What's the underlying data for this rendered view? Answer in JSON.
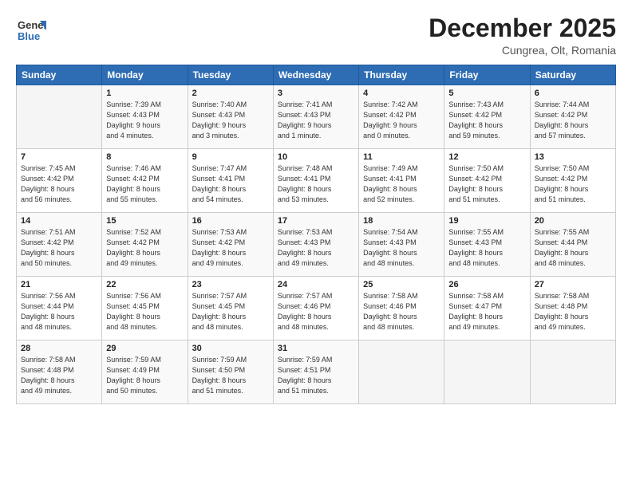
{
  "logo": {
    "line1": "General",
    "line2": "Blue"
  },
  "title": "December 2025",
  "location": "Cungrea, Olt, Romania",
  "days_of_week": [
    "Sunday",
    "Monday",
    "Tuesday",
    "Wednesday",
    "Thursday",
    "Friday",
    "Saturday"
  ],
  "weeks": [
    [
      {
        "day": "",
        "info": ""
      },
      {
        "day": "1",
        "info": "Sunrise: 7:39 AM\nSunset: 4:43 PM\nDaylight: 9 hours\nand 4 minutes."
      },
      {
        "day": "2",
        "info": "Sunrise: 7:40 AM\nSunset: 4:43 PM\nDaylight: 9 hours\nand 3 minutes."
      },
      {
        "day": "3",
        "info": "Sunrise: 7:41 AM\nSunset: 4:43 PM\nDaylight: 9 hours\nand 1 minute."
      },
      {
        "day": "4",
        "info": "Sunrise: 7:42 AM\nSunset: 4:42 PM\nDaylight: 9 hours\nand 0 minutes."
      },
      {
        "day": "5",
        "info": "Sunrise: 7:43 AM\nSunset: 4:42 PM\nDaylight: 8 hours\nand 59 minutes."
      },
      {
        "day": "6",
        "info": "Sunrise: 7:44 AM\nSunset: 4:42 PM\nDaylight: 8 hours\nand 57 minutes."
      }
    ],
    [
      {
        "day": "7",
        "info": "Sunrise: 7:45 AM\nSunset: 4:42 PM\nDaylight: 8 hours\nand 56 minutes."
      },
      {
        "day": "8",
        "info": "Sunrise: 7:46 AM\nSunset: 4:42 PM\nDaylight: 8 hours\nand 55 minutes."
      },
      {
        "day": "9",
        "info": "Sunrise: 7:47 AM\nSunset: 4:41 PM\nDaylight: 8 hours\nand 54 minutes."
      },
      {
        "day": "10",
        "info": "Sunrise: 7:48 AM\nSunset: 4:41 PM\nDaylight: 8 hours\nand 53 minutes."
      },
      {
        "day": "11",
        "info": "Sunrise: 7:49 AM\nSunset: 4:41 PM\nDaylight: 8 hours\nand 52 minutes."
      },
      {
        "day": "12",
        "info": "Sunrise: 7:50 AM\nSunset: 4:42 PM\nDaylight: 8 hours\nand 51 minutes."
      },
      {
        "day": "13",
        "info": "Sunrise: 7:50 AM\nSunset: 4:42 PM\nDaylight: 8 hours\nand 51 minutes."
      }
    ],
    [
      {
        "day": "14",
        "info": "Sunrise: 7:51 AM\nSunset: 4:42 PM\nDaylight: 8 hours\nand 50 minutes."
      },
      {
        "day": "15",
        "info": "Sunrise: 7:52 AM\nSunset: 4:42 PM\nDaylight: 8 hours\nand 49 minutes."
      },
      {
        "day": "16",
        "info": "Sunrise: 7:53 AM\nSunset: 4:42 PM\nDaylight: 8 hours\nand 49 minutes."
      },
      {
        "day": "17",
        "info": "Sunrise: 7:53 AM\nSunset: 4:43 PM\nDaylight: 8 hours\nand 49 minutes."
      },
      {
        "day": "18",
        "info": "Sunrise: 7:54 AM\nSunset: 4:43 PM\nDaylight: 8 hours\nand 48 minutes."
      },
      {
        "day": "19",
        "info": "Sunrise: 7:55 AM\nSunset: 4:43 PM\nDaylight: 8 hours\nand 48 minutes."
      },
      {
        "day": "20",
        "info": "Sunrise: 7:55 AM\nSunset: 4:44 PM\nDaylight: 8 hours\nand 48 minutes."
      }
    ],
    [
      {
        "day": "21",
        "info": "Sunrise: 7:56 AM\nSunset: 4:44 PM\nDaylight: 8 hours\nand 48 minutes."
      },
      {
        "day": "22",
        "info": "Sunrise: 7:56 AM\nSunset: 4:45 PM\nDaylight: 8 hours\nand 48 minutes."
      },
      {
        "day": "23",
        "info": "Sunrise: 7:57 AM\nSunset: 4:45 PM\nDaylight: 8 hours\nand 48 minutes."
      },
      {
        "day": "24",
        "info": "Sunrise: 7:57 AM\nSunset: 4:46 PM\nDaylight: 8 hours\nand 48 minutes."
      },
      {
        "day": "25",
        "info": "Sunrise: 7:58 AM\nSunset: 4:46 PM\nDaylight: 8 hours\nand 48 minutes."
      },
      {
        "day": "26",
        "info": "Sunrise: 7:58 AM\nSunset: 4:47 PM\nDaylight: 8 hours\nand 49 minutes."
      },
      {
        "day": "27",
        "info": "Sunrise: 7:58 AM\nSunset: 4:48 PM\nDaylight: 8 hours\nand 49 minutes."
      }
    ],
    [
      {
        "day": "28",
        "info": "Sunrise: 7:58 AM\nSunset: 4:48 PM\nDaylight: 8 hours\nand 49 minutes."
      },
      {
        "day": "29",
        "info": "Sunrise: 7:59 AM\nSunset: 4:49 PM\nDaylight: 8 hours\nand 50 minutes."
      },
      {
        "day": "30",
        "info": "Sunrise: 7:59 AM\nSunset: 4:50 PM\nDaylight: 8 hours\nand 51 minutes."
      },
      {
        "day": "31",
        "info": "Sunrise: 7:59 AM\nSunset: 4:51 PM\nDaylight: 8 hours\nand 51 minutes."
      },
      {
        "day": "",
        "info": ""
      },
      {
        "day": "",
        "info": ""
      },
      {
        "day": "",
        "info": ""
      }
    ]
  ]
}
